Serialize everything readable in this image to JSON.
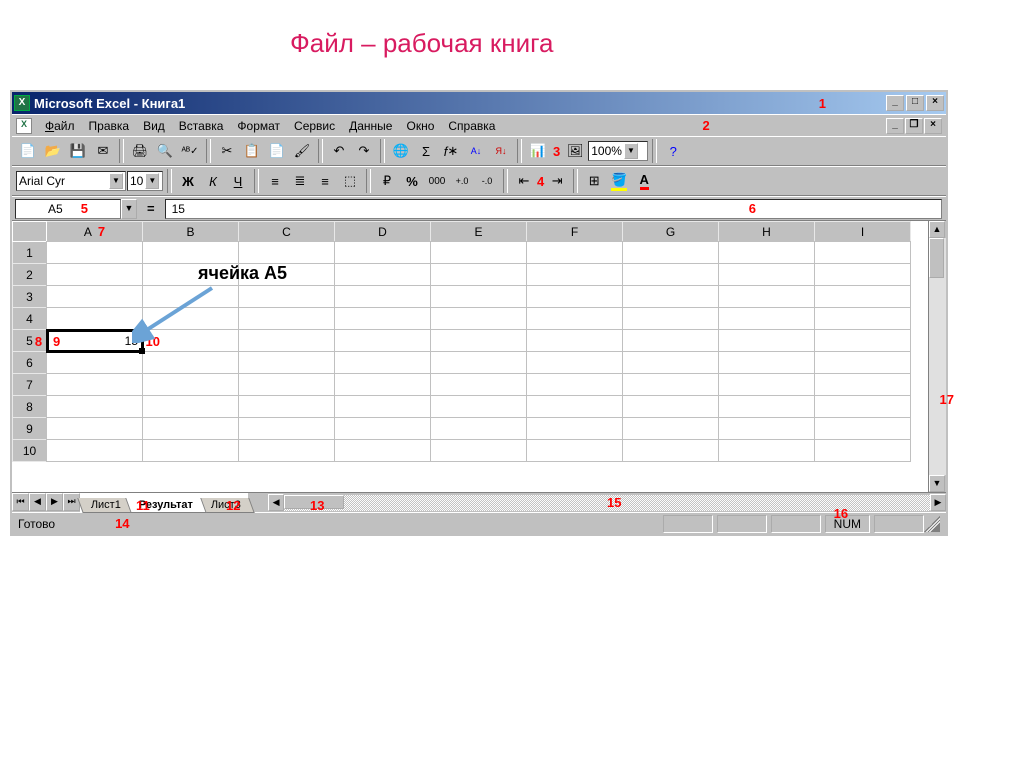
{
  "slide_title": "Файл – рабочая книга",
  "titlebar": {
    "app": "Microsoft Excel - Книга1"
  },
  "menus": [
    "Файл",
    "Правка",
    "Вид",
    "Вставка",
    "Формат",
    "Сервис",
    "Данные",
    "Окно",
    "Справка"
  ],
  "toolbar_zoom": "100%",
  "font_name": "Arial Cyr",
  "font_size": "10",
  "namebox": "A5",
  "formula_eq": "=",
  "formula_value": "15",
  "columns": [
    "A",
    "B",
    "C",
    "D",
    "E",
    "F",
    "G",
    "H",
    "I"
  ],
  "rows": [
    "1",
    "2",
    "3",
    "4",
    "5",
    "6",
    "7",
    "8",
    "9",
    "10"
  ],
  "cell_A5": "15",
  "tabs": {
    "t1": "Лист1",
    "t2": "Результат",
    "t3": "Лист3"
  },
  "status": {
    "ready": "Готово",
    "num": "NUM"
  },
  "callout_cell": "ячейка А5",
  "labels": {
    "n1": "1",
    "n2": "2",
    "n3": "3",
    "n4": "4",
    "n5": "5",
    "n6": "6",
    "n7": "7",
    "n8": "8",
    "n9": "9",
    "n10": "10",
    "n11": "11",
    "n12": "12",
    "n13": "13",
    "n14": "14",
    "n15": "15",
    "n16": "16",
    "n17": "17"
  }
}
